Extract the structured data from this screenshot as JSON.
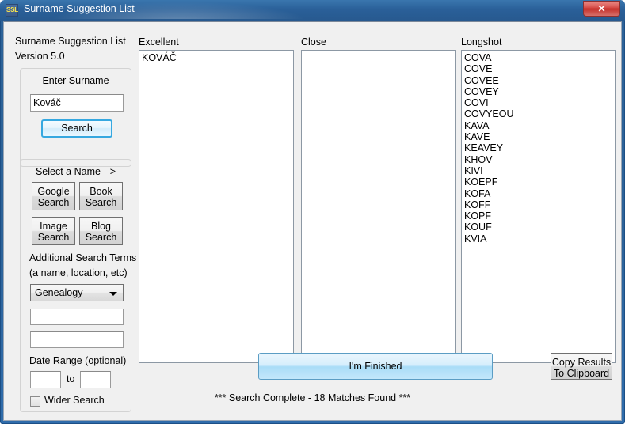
{
  "window": {
    "title": "Surname Suggestion List",
    "icon_label": "SSL",
    "icon_name": "ssl-app-icon",
    "close_label": "✕"
  },
  "sidebar": {
    "app_name": "Surname Suggestion List",
    "version": "Version 5.0",
    "enter_surname": {
      "group_title": "Enter Surname",
      "input_value": "Kováč",
      "input_placeholder": "",
      "search_button": "Search"
    },
    "select_a_name": {
      "group_title": "Select a Name -->",
      "buttons": [
        {
          "line1": "Google",
          "line2": "Search",
          "name": "google-search-button"
        },
        {
          "line1": "Book",
          "line2": "Search",
          "name": "book-search-button"
        },
        {
          "line1": "Image",
          "line2": "Search",
          "name": "image-search-button"
        },
        {
          "line1": "Blog",
          "line2": "Search",
          "name": "blog-search-button"
        }
      ],
      "additional_terms_line1": "Additional Search Terms",
      "additional_terms_line2": "(a name, location, etc)",
      "category_selected": "Genealogy",
      "term_field_1": "",
      "term_field_2": "",
      "date_range_label": "Date Range (optional)",
      "date_from": "",
      "date_to": "",
      "date_to_label": "to",
      "wider_search_label": "Wider Search",
      "wider_search_checked": false
    }
  },
  "results": {
    "columns": [
      {
        "label": "Excellent",
        "items": [
          "KOVÁČ"
        ]
      },
      {
        "label": "Close",
        "items": []
      },
      {
        "label": "Longshot",
        "items": [
          "COVA",
          "COVE",
          "COVEE",
          "COVEY",
          "COVI",
          "COVYEOU",
          "KAVA",
          "KAVE",
          "KEAVEY",
          "KHOV",
          "KIVI",
          "KOEPF",
          "KOFA",
          "KOFF",
          "KOPF",
          "KOUF",
          "KVIA"
        ]
      }
    ]
  },
  "footer": {
    "finished_button": "I'm Finished",
    "copy_button_line1": "Copy Results",
    "copy_button_line2": "To Clipboard",
    "status": "*** Search Complete - 18 Matches Found ***"
  },
  "colors": {
    "titlebar": "#2a6099",
    "close": "#c6322c",
    "accent": "#36a8e0",
    "client": "#f0f0f0"
  }
}
